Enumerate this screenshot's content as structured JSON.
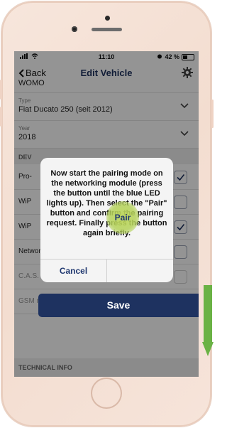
{
  "status": {
    "time": "11:10",
    "battery": "42 %"
  },
  "nav": {
    "back_label": "Back",
    "title": "Edit Vehicle"
  },
  "fields": [
    {
      "label": "",
      "value": "WOMO"
    },
    {
      "label": "Type",
      "value": "Fiat Ducato 250 (seit 2012)"
    },
    {
      "label": "Year",
      "value": "2018"
    }
  ],
  "sections": {
    "devices": "DEV",
    "technical": "TECHNICAL INFO"
  },
  "rows": [
    {
      "label": "Pro-",
      "checked": true
    },
    {
      "label": "WiP",
      "checked": false
    },
    {
      "label": "WiP",
      "checked": true
    },
    {
      "label": "Networking module",
      "checked": false
    },
    {
      "label": "C.A.S. III",
      "checked": false
    },
    {
      "label": "GSM module",
      "checked": false
    }
  ],
  "dialog": {
    "message": "Now start the pairing mode on the networking module (press the button until the blue LED lights up). Then select the \"Pair\" button and confirm the pairing request. Finally press the button again briefly.",
    "cancel_label": "Cancel",
    "pair_label": "Pair"
  },
  "save_label": "Save",
  "colors": {
    "accent": "#1e3260",
    "highlight": "#b4d25a",
    "arrow": "#6ab245"
  }
}
